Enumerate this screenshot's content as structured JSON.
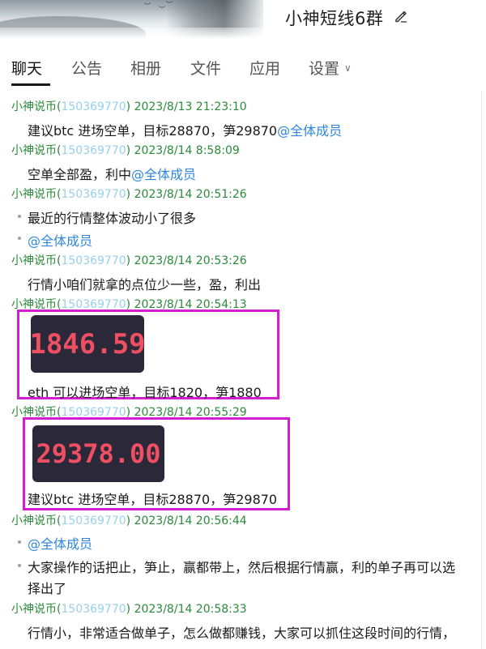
{
  "header": {
    "group_title": "小神短线6群"
  },
  "tabs": [
    {
      "label": "聊天",
      "active": true
    },
    {
      "label": "公告"
    },
    {
      "label": "相册"
    },
    {
      "label": "文件"
    },
    {
      "label": "应用"
    },
    {
      "label": "设置"
    }
  ],
  "messages": [
    {
      "sender": "小神说币(",
      "qq": "150369770",
      "close": ")",
      "time": "2023/8/13 21:23:10",
      "lines": [
        {
          "text": "建议btc 进场空单，目标28870，笋29870",
          "mention": "@全体成员"
        }
      ]
    },
    {
      "sender": "小神说币(",
      "qq": "150369770",
      "close": ")",
      "time": "2023/8/14 8:58:09",
      "lines": [
        {
          "text": "空单全部盈，利中",
          "mention": "@全体成员"
        }
      ]
    },
    {
      "sender": "小神说币(",
      "qq": "150369770",
      "close": ")",
      "time": "2023/8/14 20:51:26",
      "lines": [
        {
          "text": "最近的行情整体波动小了很多"
        },
        {
          "text": "",
          "mention": "@全体成员"
        }
      ]
    },
    {
      "sender": "小神说币(",
      "qq": "150369770",
      "close": ")",
      "time": "2023/8/14 20:53:26",
      "lines": [
        {
          "text": "行情小咱们就拿的点位少一些，盈，利出"
        }
      ]
    },
    {
      "sender": "小神说币(",
      "qq": "150369770",
      "close": ")",
      "time": "2023/8/14 20:54:13",
      "price": "1846.59",
      "caption": "eth 可以进场空单，目标1820，笋1880"
    },
    {
      "sender": "小神说币(",
      "qq": "150369770",
      "close": ")",
      "time": "2023/8/14 20:55:29",
      "price": "29378.00",
      "caption": "建议btc 进场空单，目标28870，笋29870"
    },
    {
      "sender": "小神说币(",
      "qq": "150369770",
      "close": ")",
      "time": "2023/8/14 20:56:44",
      "lines": [
        {
          "text": "",
          "mention": "@全体成员"
        },
        {
          "text": "大家操作的话把止，笋止，赢都带上，然后根据行情赢，利的单子再可以选"
        },
        {
          "text": "择出了"
        }
      ]
    },
    {
      "sender": "小神说币(",
      "qq": "150369770",
      "close": ")",
      "time": "2023/8/14 20:58:33",
      "lines": [
        {
          "text": "行情小，非常适合做单子，怎么做都赚钱，大家可以抓住这段时间的行情，"
        }
      ]
    }
  ],
  "colors": {
    "sender": "#2a8a3a",
    "mention": "#2e86de",
    "highlight_frame": "#d31fd1",
    "price_text": "#ef4f63",
    "price_bg": "#2b2839"
  },
  "icons": {
    "edit": "pencil-icon",
    "settings_dropdown": "chevron-down-icon"
  }
}
